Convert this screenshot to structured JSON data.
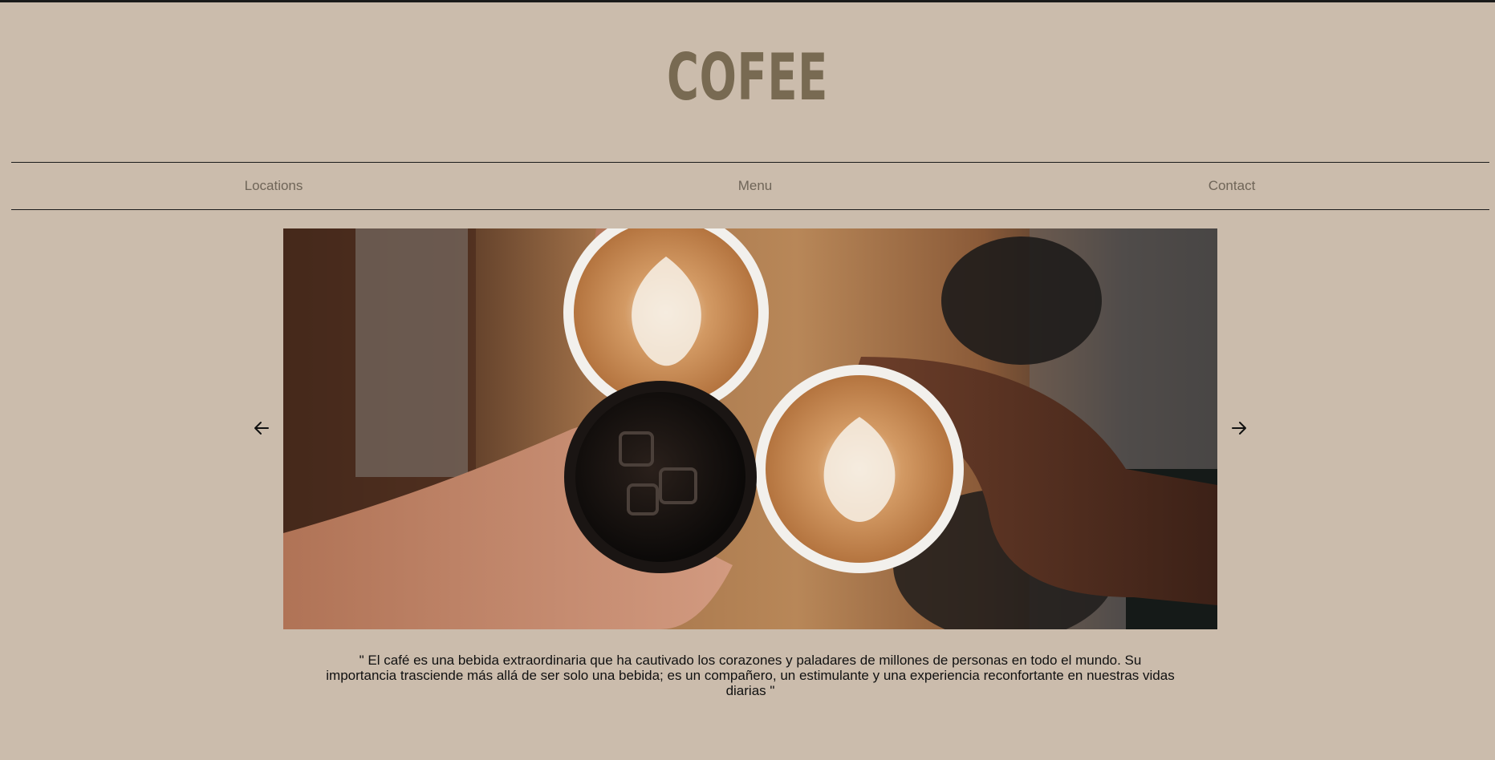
{
  "brand": {
    "logo_text": "COFEE"
  },
  "nav": {
    "items": [
      {
        "label": "Locations"
      },
      {
        "label": "Menu"
      },
      {
        "label": "Contact"
      }
    ]
  },
  "carousel": {
    "prev_icon": "arrow-left-icon",
    "next_icon": "arrow-right-icon",
    "image": {
      "alt": "Three hands toasting with coffee cups: two lattes with latte art and one iced black coffee, viewed from above"
    }
  },
  "quote": {
    "text": "\" El café es una bebida extraordinaria que ha cautivado los corazones y paladares de millones de personas en todo el mundo. Su importancia trasciende más allá de ser solo una bebida; es un compañero, un estimulante y una experiencia reconfortante en nuestras vidas diarias \""
  },
  "colors": {
    "background": "#cbbcac",
    "logo": "#786a52",
    "nav_text": "#6f6558",
    "rule": "#1a1a1a"
  }
}
